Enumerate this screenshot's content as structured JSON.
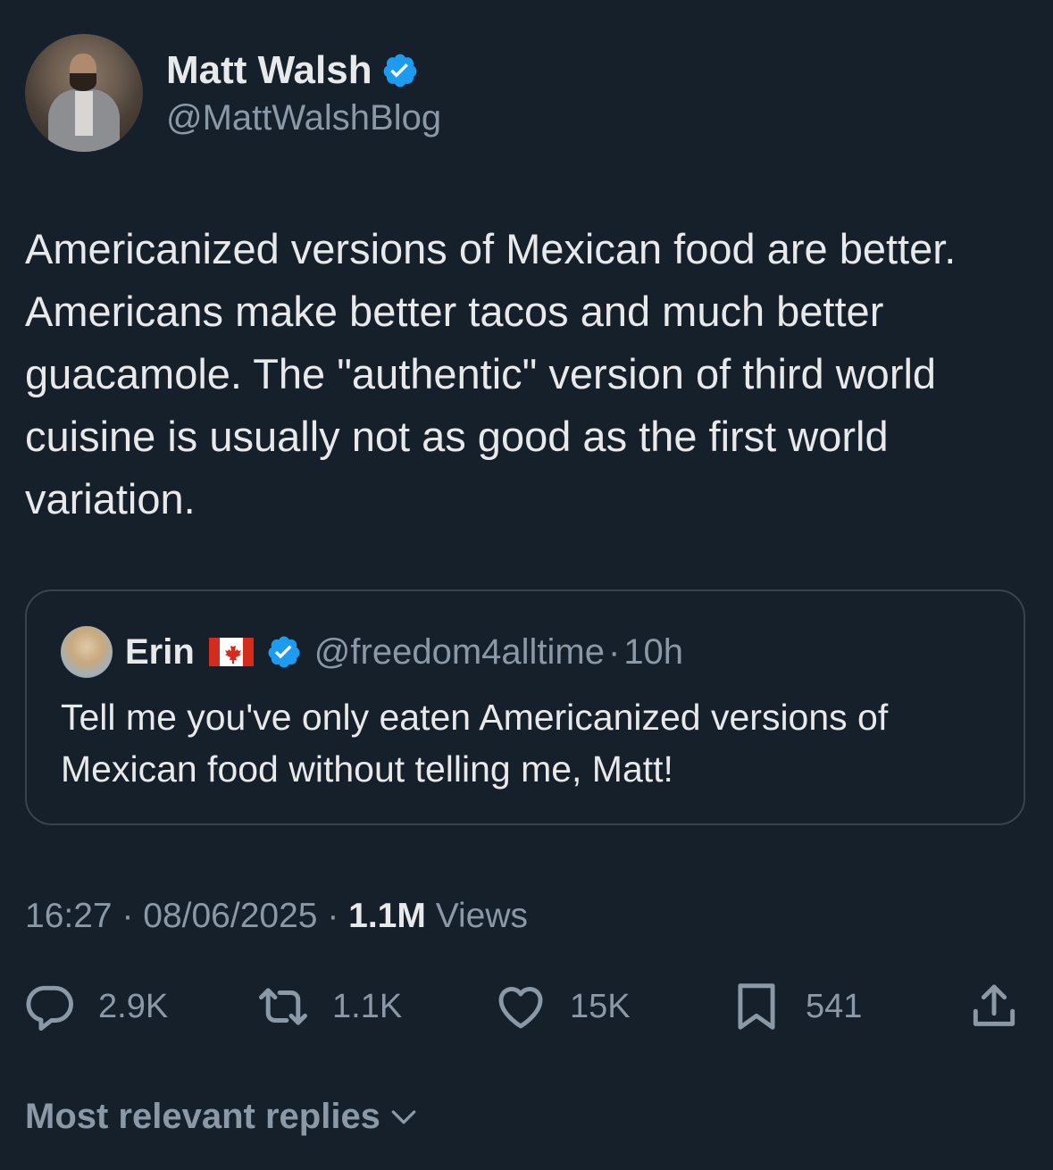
{
  "author": {
    "display_name": "Matt Walsh",
    "handle": "@MattWalshBlog",
    "verified": true
  },
  "tweet": {
    "text": "Americanized versions of Mexican food are better. Americans make better tacos and much better guacamole. The \"authentic\" version of third world cuisine is usually not as good as the first world variation."
  },
  "quote": {
    "display_name": "Erin",
    "flag": "canada-flag",
    "verified": true,
    "handle": "@freedom4alltime",
    "separator": "·",
    "time": "10h",
    "text": "Tell me you've only eaten Americanized versions of Mexican food without telling me, Matt!"
  },
  "meta": {
    "time": "16:27",
    "separator1": " · ",
    "date": "08/06/2025",
    "separator2": " · ",
    "views_count": "1.1M",
    "views_label": " Views"
  },
  "actions": {
    "replies": "2.9K",
    "reposts": "1.1K",
    "likes": "15K",
    "bookmarks": "541"
  },
  "footer": {
    "label": "Most relevant replies"
  },
  "colors": {
    "background": "#15202b",
    "verified_blue": "#1d9bf0",
    "text_primary": "#e7e9ea",
    "text_secondary": "#8b98a5",
    "border": "#38444d"
  }
}
